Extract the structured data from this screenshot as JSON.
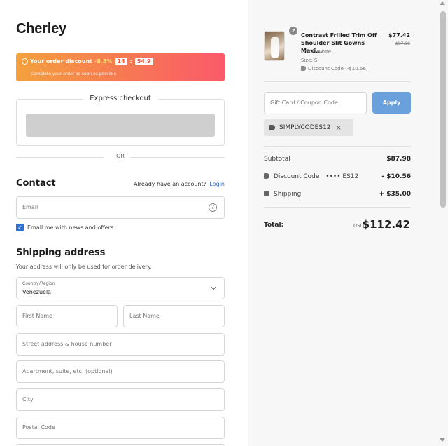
{
  "brand": "Cherley",
  "banner": {
    "title": "Your order discount",
    "percent": "-8.5%",
    "timer_min": "14",
    "timer_sep": ":",
    "timer_sec": "54.9",
    "subtitle": "Complete your order as soon as possible",
    "icon": "clock-icon"
  },
  "express": {
    "title": "Express checkout",
    "or": "OR"
  },
  "contact": {
    "heading": "Contact",
    "account_text": "Already have an account?",
    "login_link": "Login",
    "email_placeholder": "Email",
    "help_icon": "?",
    "newsletter_label": "Email me with news and offers",
    "newsletter_checked": true
  },
  "shipping": {
    "heading": "Shipping address",
    "subtitle": "Your address will only be used for order delivery.",
    "country_label": "Country/Region",
    "country_value": "Venezuela",
    "first_name": "First Name",
    "last_name": "Last Name",
    "street": "Street address & house number",
    "apartment": "Apartment, suite, etc. (optional)",
    "city": "City",
    "postal": "Postal Code"
  },
  "summary": {
    "product": {
      "quantity": "2",
      "name": "Contrast Frilled Trim Off Shoulder Slit Gowns Maxi...",
      "color": "Color: White",
      "size": "Size: S",
      "discount": "Discount Code (-$10.56)",
      "price": "$77.42",
      "old_price": "$87.98"
    },
    "coupon_placeholder": "Gift Card / Coupon Code",
    "apply_label": "Apply",
    "applied_code": "SIMPLYCODES12",
    "remove_icon": "×",
    "subtotal_label": "Subtotal",
    "subtotal_value": "$87.98",
    "discount_label": "Discount Code",
    "discount_code": "•••• ES12",
    "discount_value": "- $10.56",
    "shipping_label": "Shipping",
    "shipping_value": "+ $35.00",
    "total_label": "Total:",
    "currency": "USD",
    "total_value": "$112.42"
  },
  "colors": {
    "accent": "#2d6fd3",
    "apply_button": "#6aa0db",
    "banner_start": "#f4a13e",
    "banner_end": "#fb5a6a"
  }
}
